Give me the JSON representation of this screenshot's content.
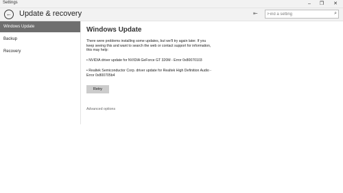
{
  "window": {
    "title": "Settings",
    "controls": [
      "–",
      "❐",
      "✕"
    ]
  },
  "header": {
    "back_icon": "←",
    "title": "Update & recovery",
    "pin_icon": "⇤"
  },
  "search": {
    "placeholder": "Find a setting",
    "icon": "⌕"
  },
  "sidebar": {
    "items": [
      {
        "label": "Windows Update",
        "active": true
      },
      {
        "label": "Backup",
        "active": false
      },
      {
        "label": "Recovery",
        "active": false
      }
    ]
  },
  "main": {
    "title": "Windows Update",
    "message": "There were problems installing some updates, but we'll try again later. If you keep seeing this and want to search the web or contact support for information, this may help:",
    "errors": [
      "• NVIDIA driver update for NVIDIA GeForce GT 320M - Error 0x80070103",
      "• Realtek Semiconductor Corp. driver update for Realtek High Definition Audio - Error 0x800705b4"
    ],
    "retry_label": "Retry",
    "advanced_link": "Advanced options"
  },
  "colors": {
    "active_bg": "#6e6e6e",
    "chrome_bg": "#f2f2f2",
    "button_bg": "#cccccc"
  }
}
